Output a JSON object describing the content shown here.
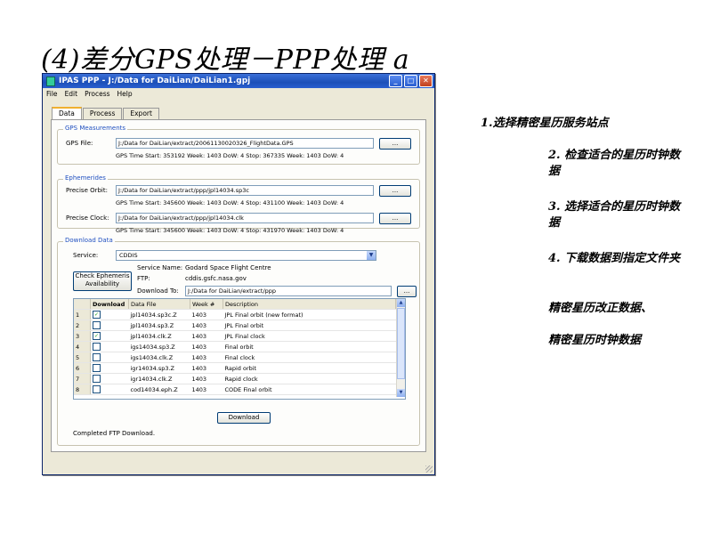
{
  "slide": {
    "title": "(4)差分GPS处理－PPP处理 a"
  },
  "window": {
    "title": "IPAS PPP - J:/Data for DaiLian/DaiLian1.gpj",
    "menu": [
      "File",
      "Edit",
      "Process",
      "Help"
    ],
    "tabs": [
      "Data",
      "Process",
      "Export"
    ],
    "active_tab": "Data"
  },
  "gps_measurements": {
    "group_label": "GPS Measurements",
    "file_label": "GPS File:",
    "file_value": "J:/Data for DaiLian/extract/20061130020326_FlightData.GPS",
    "browse_label": "...",
    "time_info": "GPS Time  Start: 353192  Week: 1403  DoW: 4   Stop: 367335  Week: 1403  DoW: 4"
  },
  "ephemerides": {
    "group_label": "Ephemerides",
    "orbit_label": "Precise Orbit:",
    "orbit_value": "J:/Data for DaiLian/extract/ppp/jpl14034.sp3c",
    "orbit_time": "GPS Time  Start: 345600  Week: 1403  DoW: 4   Stop: 431100  Week: 1403  DoW: 4",
    "clock_label": "Precise Clock:",
    "clock_value": "J:/Data for DaiLian/extract/ppp/jpl14034.clk",
    "clock_time": "GPS Time  Start: 345600  Week: 1403  DoW: 4   Stop: 431970  Week: 1403  DoW: 4",
    "browse_label": "..."
  },
  "download": {
    "group_label": "Download Data",
    "service_label": "Service:",
    "service_value": "CDDIS",
    "service_name_label": "Service Name:",
    "service_name_value": "Godard Space Flight Centre",
    "ftp_label": "FTP:",
    "ftp_value": "cddis.gsfc.nasa.gov",
    "download_to_label": "Download To:",
    "download_to_value": "J:/Data for DaiLian/extract/ppp",
    "check_button": "Check Ephemeris Availability",
    "browse_label": "...",
    "columns": [
      "",
      "Download",
      "Data File",
      "Week #",
      "Description"
    ],
    "rows": [
      {
        "n": "1",
        "checked": true,
        "file": "jpl14034.sp3c.Z",
        "week": "1403",
        "desc": "JPL Final orbit (new format)"
      },
      {
        "n": "2",
        "checked": false,
        "file": "jpl14034.sp3.Z",
        "week": "1403",
        "desc": "JPL Final orbit"
      },
      {
        "n": "3",
        "checked": true,
        "file": "jpl14034.clk.Z",
        "week": "1403",
        "desc": "JPL Final clock"
      },
      {
        "n": "4",
        "checked": false,
        "file": "igs14034.sp3.Z",
        "week": "1403",
        "desc": "Final orbit"
      },
      {
        "n": "5",
        "checked": false,
        "file": "igs14034.clk.Z",
        "week": "1403",
        "desc": "Final clock"
      },
      {
        "n": "6",
        "checked": false,
        "file": "igr14034.sp3.Z",
        "week": "1403",
        "desc": "Rapid orbit"
      },
      {
        "n": "7",
        "checked": false,
        "file": "igr14034.clk.Z",
        "week": "1403",
        "desc": "Rapid clock"
      },
      {
        "n": "8",
        "checked": false,
        "file": "cod14034.eph.Z",
        "week": "1403",
        "desc": "CODE Final orbit"
      }
    ],
    "download_button": "Download",
    "status": "Completed FTP Download."
  },
  "notes": [
    "1.选择精密星历服务站点",
    "2. 检查适合的星历时钟数据",
    "3. 选择适合的星历时钟数据",
    "4. 下载数据到指定文件夹",
    "精密星历改正数据、",
    "精密星历时钟数据"
  ]
}
